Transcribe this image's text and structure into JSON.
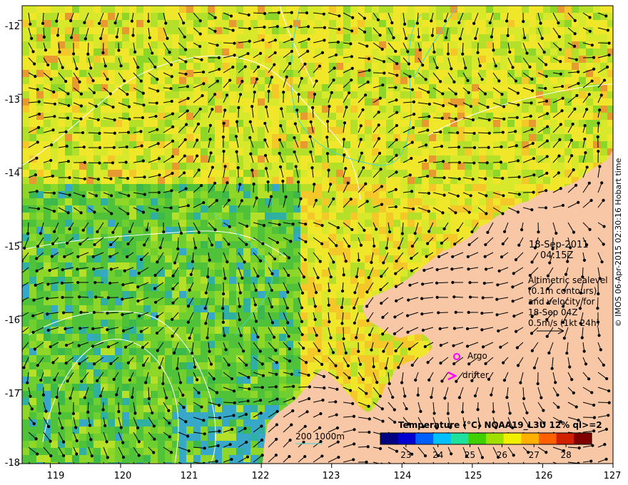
{
  "map": {
    "lon_range": [
      118.6,
      127
    ],
    "lat_range": [
      -18,
      -11.8
    ],
    "lon_ticks": [
      119,
      120,
      121,
      122,
      123,
      124,
      125,
      126,
      127
    ],
    "lat_ticks": [
      -12,
      -13,
      -14,
      -15,
      -16,
      -17,
      -18
    ],
    "land_color": "#f7c7a6",
    "frame_color": "#000000",
    "contour_color": "#ffffff",
    "bathy_color": "#3fd6d6"
  },
  "info": {
    "date": "18-Sep-2011",
    "time": "04:15Z",
    "line1": "Altimetric sealevel",
    "line2": "(0.1m contours)",
    "line3": "and velocity for",
    "line4": "18-Sep 04Z",
    "line5": "0.5m/s (1kt 24h)"
  },
  "legend": {
    "argo_label": "Argo",
    "drifter_label": "drifter",
    "marker_color": "#ff00ff",
    "bathy_label": "200  1000m"
  },
  "colorbar": {
    "title": "Temperature (°C) NOAA19_L3U 12% ql>=2",
    "ticks": [
      23,
      24,
      25,
      26,
      27,
      28
    ],
    "range": [
      22.2,
      28.8
    ],
    "colors": [
      "#000080",
      "#0000d0",
      "#0060ff",
      "#00c0ff",
      "#20e0a0",
      "#40d000",
      "#a0e000",
      "#f0f000",
      "#ffb000",
      "#ff6000",
      "#d02000",
      "#800000"
    ]
  },
  "credit": "© IMOS 06-Apr-2015 02:30:16 Hobart time"
}
